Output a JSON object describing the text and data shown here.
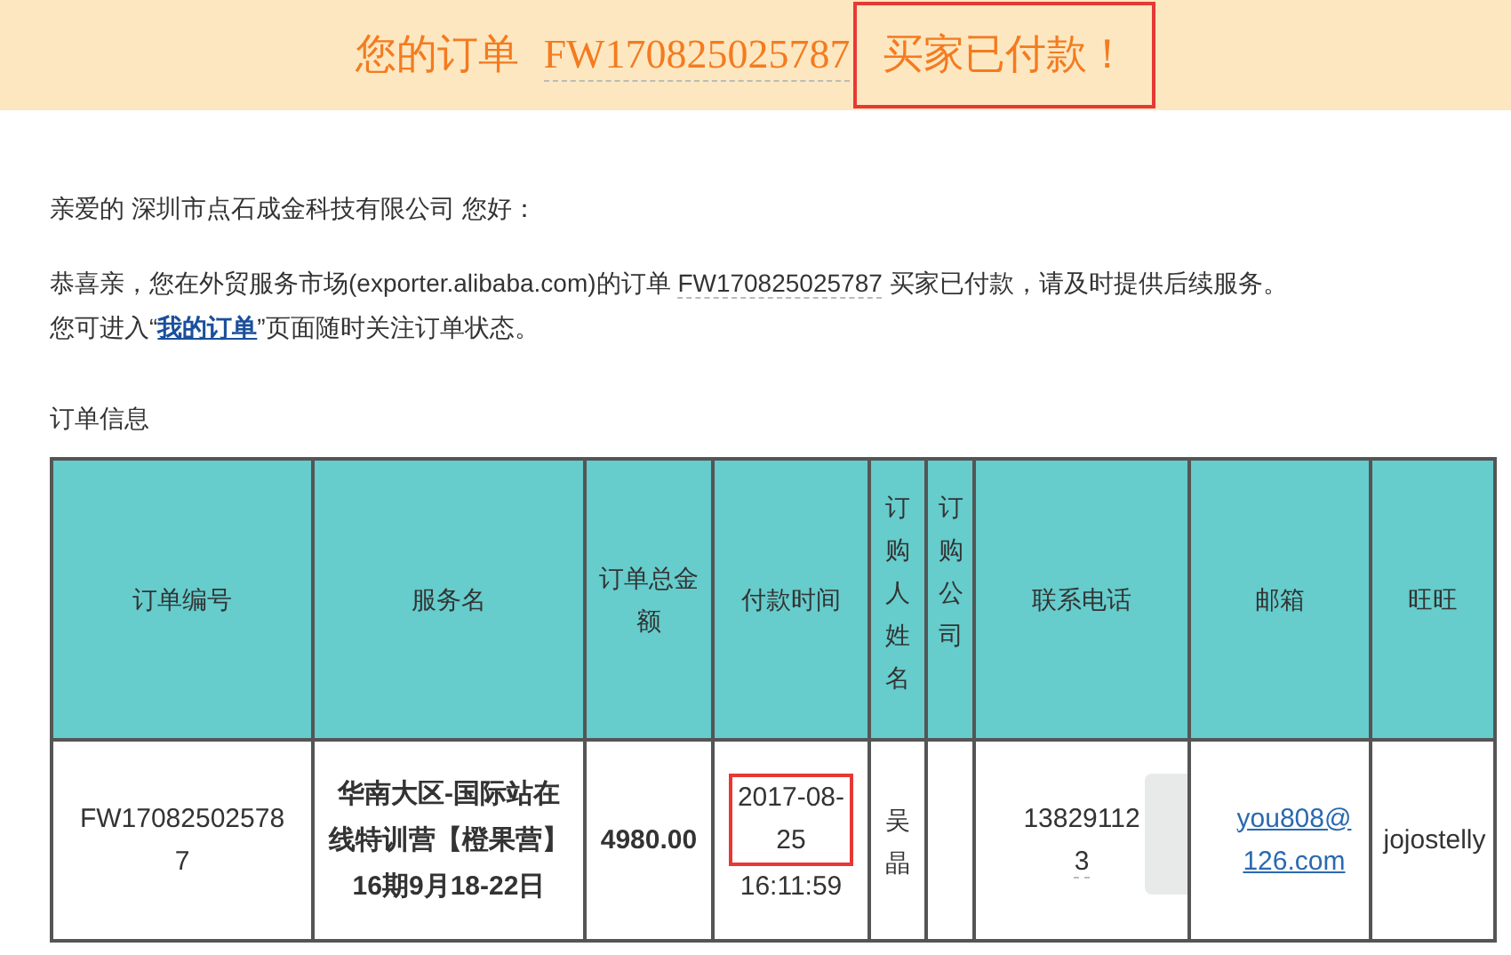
{
  "banner": {
    "prefix": "您的订单",
    "order_no": "FW170825025787",
    "status": "买家已付款！",
    "status_highlighted": true
  },
  "greeting": "亲爱的 深圳市点石成金科技有限公司 您好：",
  "message": {
    "before": "恭喜亲，您在外贸服务市场(exporter.alibaba.com)的订单 ",
    "order_no": "FW170825025787",
    "after": " 买家已付款，请及时提供后续服务。"
  },
  "follow": {
    "before": "您可进入“",
    "link": "我的订单",
    "after": "”页面随时关注订单状态。"
  },
  "section_title": "订单信息",
  "table": {
    "columns": [
      "订单编号",
      "服务名",
      "订单总金额",
      "付款时间",
      "订购人姓名",
      "订购公司",
      "联系电话",
      "邮箱",
      "旺旺"
    ],
    "rows": [
      {
        "order_no": "FW170825025787",
        "service": "华南大区-国际站在线特训营【橙果营】16期9月18-22日",
        "amount": "4980.00",
        "pay_date": "2017-08-25",
        "pay_date_highlighted": true,
        "pay_time": "16:11:59",
        "buyer": "吴晶",
        "company": "",
        "phone_lines": [
          "13829112",
          "3"
        ],
        "email_lines": [
          "you808@",
          "126.com"
        ],
        "wangwang": "jojostelly",
        "blurred": true
      }
    ]
  }
}
